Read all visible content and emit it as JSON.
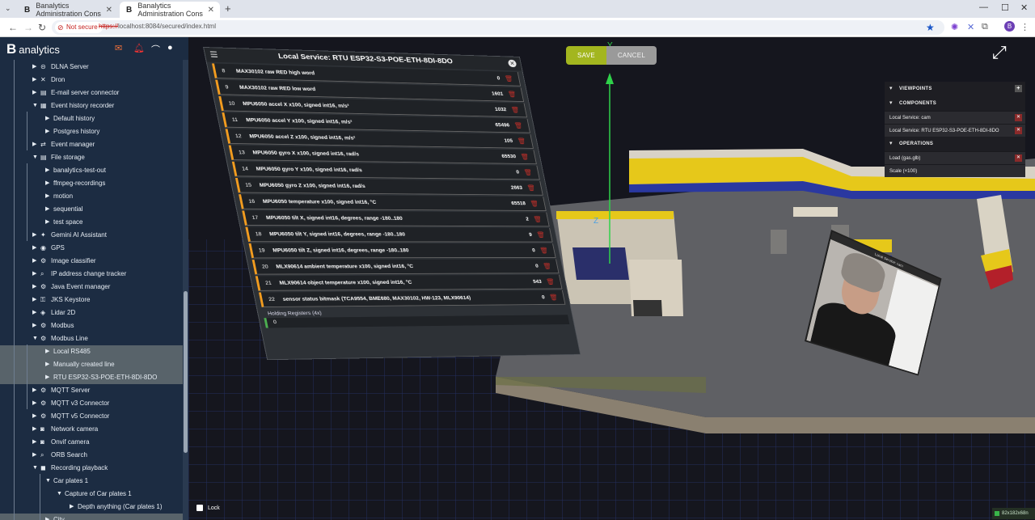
{
  "browser": {
    "tabs": [
      {
        "title": "Banalytics Administration Cons"
      },
      {
        "title": "Banalytics Administration Cons"
      }
    ],
    "not_secure_label": "Not secure",
    "url_scheme": "https://",
    "url_rest": "localhost:8084/secured/index.html",
    "profile_initial": "B"
  },
  "app": {
    "logo_letter": "B",
    "logo_text": "analytics"
  },
  "sidebar": {
    "items": [
      {
        "label": "DLNA Server",
        "depth": 1,
        "caret": "right",
        "icon": "dlna-icon"
      },
      {
        "label": "Dron",
        "depth": 1,
        "caret": "right",
        "icon": "drone-icon"
      },
      {
        "label": "E-mail server connector",
        "depth": 1,
        "caret": "right",
        "icon": "email-server-icon"
      },
      {
        "label": "Event history recorder",
        "depth": 1,
        "caret": "down",
        "icon": "history-icon"
      },
      {
        "label": "Default history",
        "depth": 2,
        "caret": "right",
        "icon": ""
      },
      {
        "label": "Postgres history",
        "depth": 2,
        "caret": "right",
        "icon": ""
      },
      {
        "label": "Event manager",
        "depth": 1,
        "caret": "right",
        "icon": "event-manager-icon"
      },
      {
        "label": "File storage",
        "depth": 1,
        "caret": "down",
        "icon": "folder-icon"
      },
      {
        "label": "banalytics-test-out",
        "depth": 2,
        "caret": "right",
        "icon": ""
      },
      {
        "label": "ffmpeg-recordings",
        "depth": 2,
        "caret": "right",
        "icon": ""
      },
      {
        "label": "motion",
        "depth": 2,
        "caret": "right",
        "icon": ""
      },
      {
        "label": "sequential",
        "depth": 2,
        "caret": "right",
        "icon": ""
      },
      {
        "label": "test space",
        "depth": 2,
        "caret": "right",
        "icon": ""
      },
      {
        "label": "Gemini AI Assistant",
        "depth": 1,
        "caret": "right",
        "icon": "gemini-icon"
      },
      {
        "label": "GPS",
        "depth": 1,
        "caret": "right",
        "icon": "gps-icon"
      },
      {
        "label": "Image classifier",
        "depth": 1,
        "caret": "right",
        "icon": "image-classifier-icon"
      },
      {
        "label": "IP address change tracker",
        "depth": 1,
        "caret": "right",
        "icon": "search-icon"
      },
      {
        "label": "Java Event manager",
        "depth": 1,
        "caret": "right",
        "icon": "java-event-icon"
      },
      {
        "label": "JKS Keystore",
        "depth": 1,
        "caret": "right",
        "icon": "keystore-icon"
      },
      {
        "label": "Lidar 2D",
        "depth": 1,
        "caret": "right",
        "icon": "lidar-icon"
      },
      {
        "label": "Modbus",
        "depth": 1,
        "caret": "right",
        "icon": "modbus-icon"
      },
      {
        "label": "Modbus Line",
        "depth": 1,
        "caret": "down",
        "icon": "modbus-line-icon"
      },
      {
        "label": "Local RS485",
        "depth": 2,
        "caret": "right",
        "icon": "",
        "selected": true
      },
      {
        "label": "Manually created line",
        "depth": 2,
        "caret": "right",
        "icon": "",
        "selected": true
      },
      {
        "label": "RTU ESP32-S3-POE-ETH-8DI-8DO",
        "depth": 2,
        "caret": "right",
        "icon": "",
        "selected": true
      },
      {
        "label": "MQTT Server",
        "depth": 1,
        "caret": "right",
        "icon": "mqtt-icon"
      },
      {
        "label": "MQTT v3 Connector",
        "depth": 1,
        "caret": "right",
        "icon": "mqtt-icon"
      },
      {
        "label": "MQTT v5 Connector",
        "depth": 1,
        "caret": "right",
        "icon": "mqtt-icon"
      },
      {
        "label": "Network camera",
        "depth": 1,
        "caret": "right",
        "icon": "camera-icon"
      },
      {
        "label": "Onvif camera",
        "depth": 1,
        "caret": "right",
        "icon": "camera-icon"
      },
      {
        "label": "ORB Search",
        "depth": 1,
        "caret": "right",
        "icon": "orb-search-icon"
      },
      {
        "label": "Recording playback",
        "depth": 1,
        "caret": "down",
        "icon": "playback-icon"
      },
      {
        "label": "Car plates 1",
        "depth": 2,
        "caret": "down",
        "icon": ""
      },
      {
        "label": "Capture of Car plates 1",
        "depth": 3,
        "caret": "down",
        "icon": ""
      },
      {
        "label": "Depth anything (Car plates 1)",
        "depth": 4,
        "caret": "right",
        "icon": ""
      },
      {
        "label": "City",
        "depth": 2,
        "caret": "right",
        "icon": "",
        "selected": true
      }
    ]
  },
  "viewport": {
    "save_label": "SAVE",
    "cancel_label": "CANCEL",
    "lock_label": "Lock",
    "axis_z_label": "Z",
    "axis_y_label": "Y",
    "coords_label": "82x182x68n"
  },
  "right_panel": {
    "viewpoints_label": "VIEWPOINTS",
    "components_label": "COMPONENTS",
    "components": [
      "Local Service: cam",
      "Local Service: RTU ESP32-S3-POE-ETH-8DI-8DO"
    ],
    "operations_label": "OPERATIONS",
    "operations": [
      "Load (gas.glb)",
      "Scale (×100)"
    ]
  },
  "service_panel": {
    "title": "Local Service: RTU ESP32-S3-POE-ETH-8DI-8DO",
    "registers": [
      {
        "index": "8",
        "name": "MAX30102 raw RED high word",
        "value": "0"
      },
      {
        "index": "9",
        "name": "MAX30102 raw RED low word",
        "value": "1601"
      },
      {
        "index": "10",
        "name": "MPU6050 accel X x100, signed int16, m/s²",
        "value": "1032"
      },
      {
        "index": "11",
        "name": "MPU6050 accel Y x100, signed int16, m/s²",
        "value": "65496"
      },
      {
        "index": "12",
        "name": "MPU6050 accel Z x100, signed int16, m/s²",
        "value": "105"
      },
      {
        "index": "13",
        "name": "MPU6050 gyro X x100, signed int16, rad/s",
        "value": "65530"
      },
      {
        "index": "14",
        "name": "MPU6050 gyro Y x100, signed int16, rad/s",
        "value": "0"
      },
      {
        "index": "15",
        "name": "MPU6050 gyro Z x100, signed int16, rad/s",
        "value": "2663"
      },
      {
        "index": "16",
        "name": "MPU6050 temperature x100, signed int16, °C",
        "value": "65518"
      },
      {
        "index": "17",
        "name": "MPU6050 tilt X, signed int16, degrees, range -180..180",
        "value": "2"
      },
      {
        "index": "18",
        "name": "MPU6050 tilt Y, signed int16, degrees, range -180..180",
        "value": "9"
      },
      {
        "index": "19",
        "name": "MPU6050 tilt Z, signed int16, degrees, range -180..180",
        "value": "0"
      },
      {
        "index": "20",
        "name": "MLX90614 ambient temperature x100, signed int16, °C",
        "value": "0"
      },
      {
        "index": "21",
        "name": "MLX90614 object temperature x100, signed int16, °C",
        "value": "543"
      },
      {
        "index": "22",
        "name": "sensor status bitmask (TCA9554, BME680, MAX30102, HW-123, MLX90614)",
        "value": "0"
      }
    ],
    "holding_label": "Holding Registers (4x)",
    "holding_first_index": "0"
  },
  "camera": {
    "title": "Local Service: cam"
  }
}
